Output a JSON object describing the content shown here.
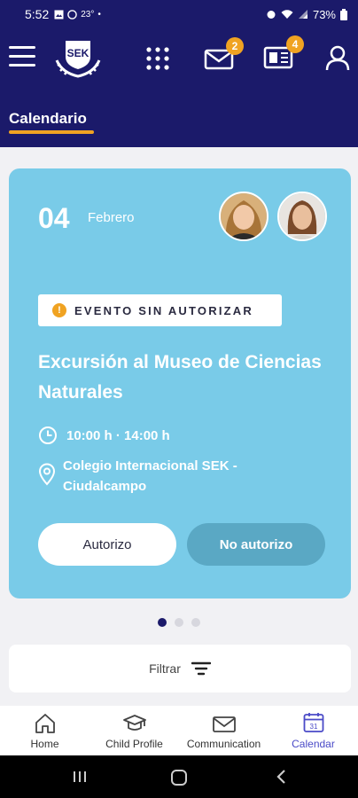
{
  "status_bar": {
    "time": "5:52",
    "temperature": "23°",
    "battery": "73%"
  },
  "header": {
    "mail_badge": "2",
    "news_badge": "4",
    "logo_text": "SEK"
  },
  "section": {
    "title": "Calendario"
  },
  "event": {
    "day": "04",
    "month": "Febrero",
    "status": "EVENTO SIN AUTORIZAR",
    "title": "Excursión al Museo de Ciencias Naturales",
    "time": "10:00 h · 14:00 h",
    "location": "Colegio Internacional SEK - Ciudalcampo",
    "authorize_label": "Autorizo",
    "deny_label": "No autorizo"
  },
  "pagination": {
    "current": 1,
    "total": 3
  },
  "filter": {
    "label": "Filtrar"
  },
  "bottom_nav": {
    "items": [
      {
        "label": "Home",
        "icon": "home-icon"
      },
      {
        "label": "Child Profile",
        "icon": "graduation-cap-icon"
      },
      {
        "label": "Communication",
        "icon": "envelope-icon"
      },
      {
        "label": "Calendar",
        "icon": "calendar-icon"
      }
    ],
    "active_index": 3
  },
  "colors": {
    "brand_navy": "#1b1a6a",
    "accent_orange": "#f0a322",
    "card_blue": "#79cbe8",
    "active_nav": "#4a4ac7"
  }
}
